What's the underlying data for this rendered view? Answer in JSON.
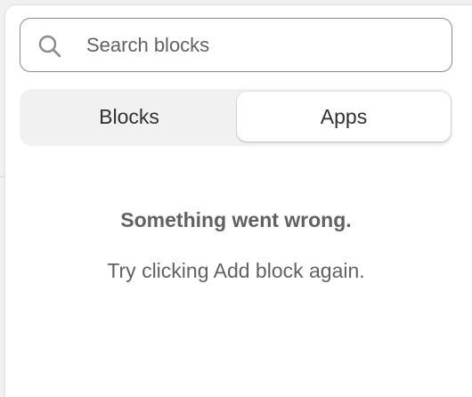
{
  "search": {
    "placeholder": "Search blocks",
    "value": "",
    "icon": "search-icon"
  },
  "tabs": [
    {
      "label": "Blocks",
      "selected": false
    },
    {
      "label": "Apps",
      "selected": true
    }
  ],
  "empty_state": {
    "title": "Something went wrong.",
    "message": "Try clicking Add block again."
  },
  "colors": {
    "text_primary": "#303030",
    "text_secondary": "#616161",
    "border": "#8a8a8a",
    "segment_bg": "#f1f1f1"
  }
}
